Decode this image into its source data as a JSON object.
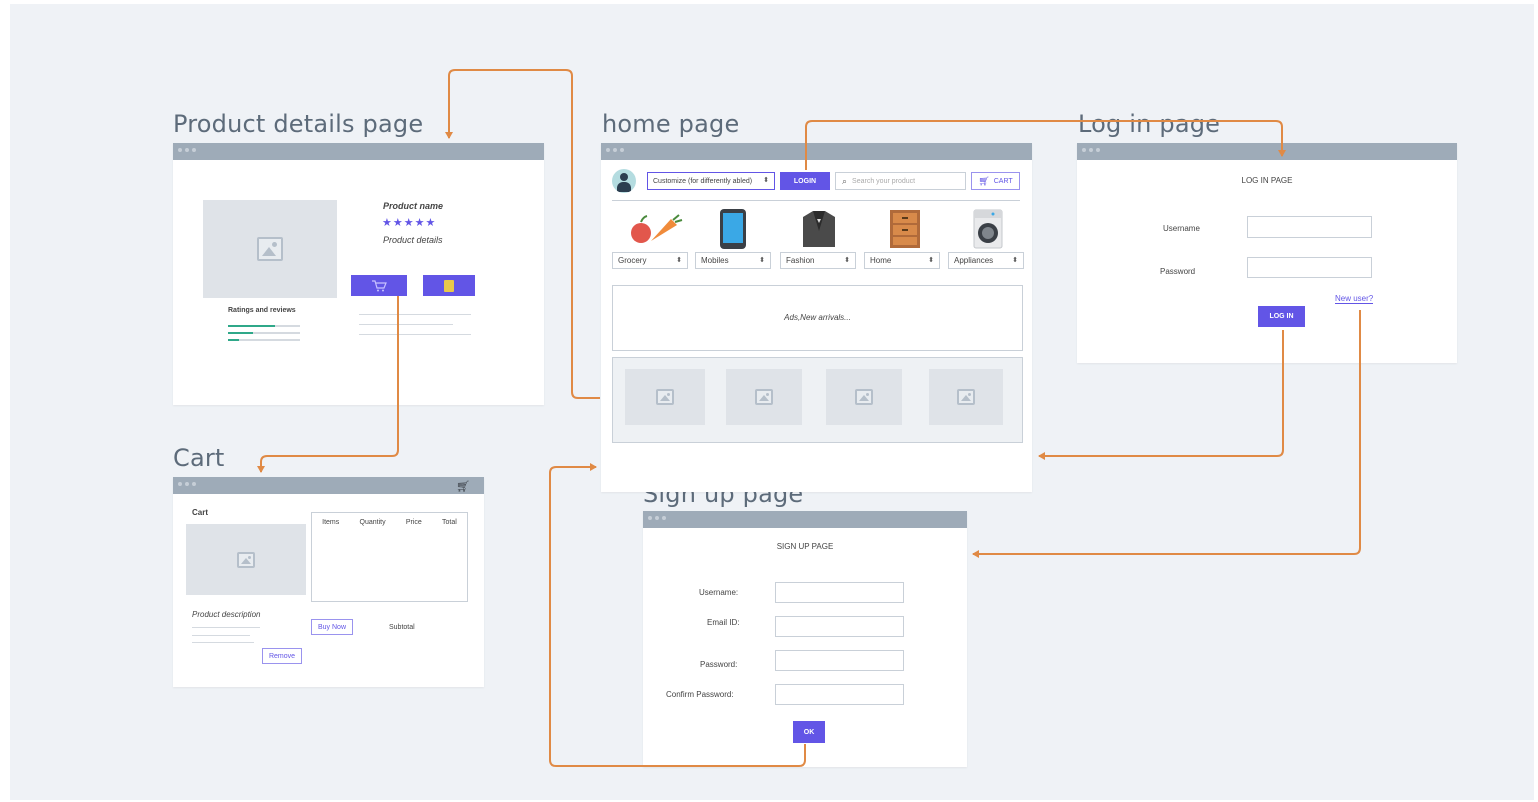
{
  "titles": {
    "product": "Product details page",
    "home": "home page",
    "login": "Log in page",
    "cart": "Cart",
    "signup": "Sign up page"
  },
  "product": {
    "name": "Product name",
    "stars": "★★★★★",
    "details": "Product details",
    "ratings": "Ratings and reviews",
    "rating_bars": [
      0.65,
      0.35,
      0.15
    ]
  },
  "home": {
    "customize": "Customize (for differently abled)",
    "login": "LOGIN",
    "search_placeholder": "Search your product",
    "cart": "CART",
    "categories": [
      "Grocery",
      "Mobiles",
      "Fashion",
      "Home",
      "Appliances"
    ],
    "ads": "Ads,New arrivals..."
  },
  "login": {
    "heading": "LOG IN PAGE",
    "username": "Username",
    "password": "Password",
    "new_user": "New user?",
    "button": "LOG IN"
  },
  "cart": {
    "heading": "Cart",
    "columns": [
      "Items",
      "Quantity",
      "Price",
      "Total"
    ],
    "description": "Product description",
    "buy_now": "Buy Now",
    "subtotal": "Subtotal",
    "remove": "Remove"
  },
  "signup": {
    "heading": "SIGN UP PAGE",
    "username": "Username:",
    "email": "Email ID:",
    "password": "Password:",
    "confirm": "Confirm Password:",
    "button": "OK"
  },
  "colors": {
    "accent": "#6255e6",
    "arrow": "#e08a45",
    "titlebar": "#9eabb8",
    "background": "#eff2f6"
  }
}
